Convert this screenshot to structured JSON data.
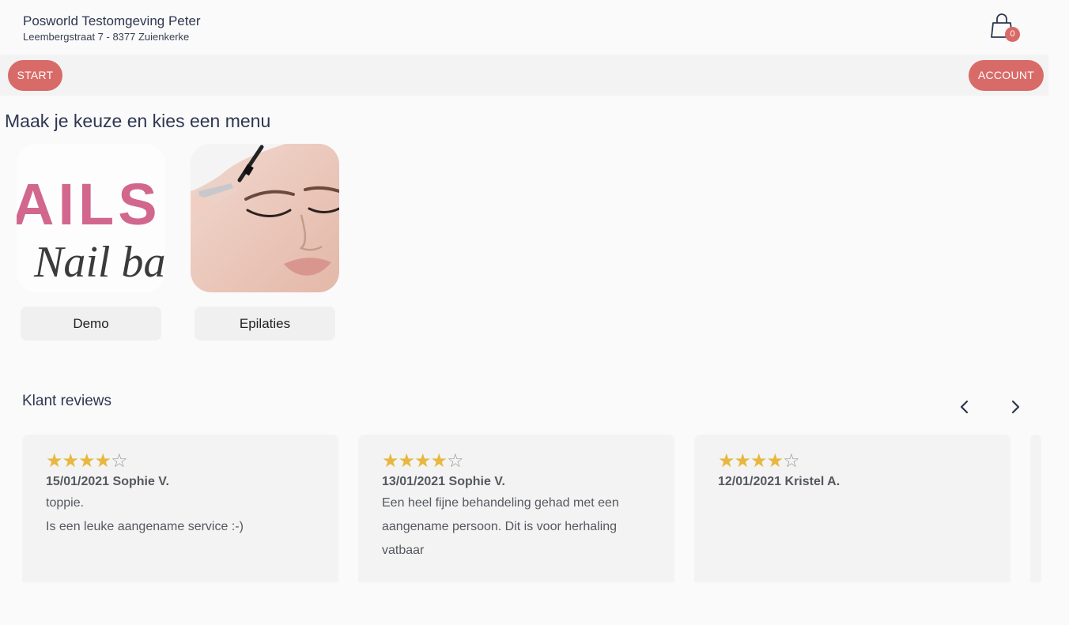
{
  "header": {
    "shop_name": "Posworld Testomgeving Peter",
    "shop_address": "Leembergstraat 7 - 8377 Zuienkerke",
    "cart_count": "0",
    "cart_icon": "shopping-bag-icon"
  },
  "nav": {
    "start_label": "START",
    "account_label": "ACCOUNT"
  },
  "menu_section": {
    "title": "Maak je keuze en kies een menu",
    "items": [
      {
        "label": "Demo",
        "image_text_top": "AILS",
        "image_text_bottom": "Nail bar"
      },
      {
        "label": "Epilaties"
      }
    ]
  },
  "reviews": {
    "title": "Klant reviews",
    "prev_icon": "chevron-left-icon",
    "next_icon": "chevron-right-icon",
    "items": [
      {
        "rating": 4,
        "max": 5,
        "header": "15/01/2021 Sophie V.",
        "lines": [
          "toppie.",
          "Is een leuke aangename service :-)"
        ]
      },
      {
        "rating": 4,
        "max": 5,
        "header": "13/01/2021 Sophie V.",
        "lines": [
          "Een heel fijne behandeling gehad met een",
          "aangename persoon. Dit is voor herhaling",
          "vatbaar"
        ]
      },
      {
        "rating": 4,
        "max": 5,
        "header": "12/01/2021 Kristel A.",
        "lines": []
      }
    ]
  },
  "colors": {
    "accent": "#d86a68",
    "star": "#e8b73e"
  }
}
